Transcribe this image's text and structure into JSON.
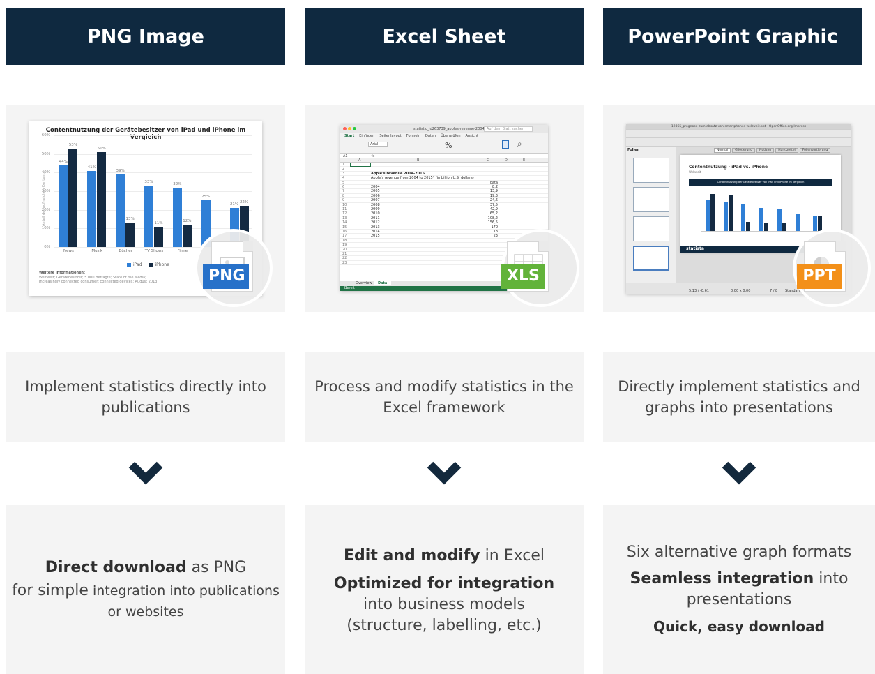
{
  "colors": {
    "header_bg": "#0f2940",
    "panel_bg": "#f4f4f4",
    "png_badge": "#2771c9",
    "xls_badge": "#62b33a",
    "ppt_badge": "#f39019",
    "ipad": "#2f7fd6",
    "iphone": "#142a42"
  },
  "columns": [
    {
      "title": "PNG Image",
      "badge": "PNG",
      "description": "Implement statistics directly into publications",
      "bottom": {
        "line1_bold": "Direct download",
        "line1_rest": " as PNG",
        "line2_big": "for simple",
        "line2_small": " integration into publications or websites"
      }
    },
    {
      "title": "Excel Sheet",
      "badge": "XLS",
      "description": "Process and modify statistics in the Excel framework",
      "bottom": {
        "p1_bold": "Edit and modify",
        "p1_rest": " in Excel",
        "p2_bold": "Optimized for integration",
        "p2_rest": "into business models",
        "p3_rest": "(structure, labelling, etc.)"
      }
    },
    {
      "title": "PowerPoint Graphic",
      "badge": "PPT",
      "description": "Directly implement statistics and graphs into presentations",
      "bottom": {
        "p1": "Six alternative graph formats",
        "p2_bold": "Seamless integration",
        "p2_rest": " into presentations",
        "p3_bold": "Quick, easy download"
      }
    }
  ],
  "png_chart": {
    "title": "Contentnutzung der Gerätebesitzer von iPad und iPhone im Vergleich",
    "ylabel": "Anteil der auf-reichen Contents",
    "yticks": [
      "60%",
      "50%",
      "40%",
      "30%",
      "20%",
      "10%",
      "0%"
    ],
    "legend": [
      "iPad",
      "iPhone"
    ],
    "footnote_title": "Weitere Informationen:",
    "footnote_l1": "Weltweit; Gerätebesitzer; 5.000 Befragte; State of the Media;",
    "footnote_l2": "Increasingly connected consumer; connected devices; August 2013"
  },
  "chart_data": {
    "type": "bar",
    "title": "Contentnutzung der Gerätebesitzer von iPad und iPhone im Vergleich",
    "categories": [
      "News",
      "Musik",
      "Bücher",
      "TV Shows",
      "Filme",
      "",
      ""
    ],
    "series": [
      {
        "name": "iPad",
        "values": [
          44,
          41,
          39,
          33,
          32,
          25,
          21
        ]
      },
      {
        "name": "iPhone",
        "values": [
          53,
          51,
          13,
          11,
          12,
          null,
          22
        ]
      }
    ],
    "value_labels_ipad": [
      "44%",
      "41%",
      "39%",
      "33%",
      "32%",
      "25%",
      "21%"
    ],
    "value_labels_iphone": [
      "53%",
      "51%",
      "13%",
      "11%",
      "12%",
      "",
      "22%"
    ],
    "ylim": [
      0,
      60
    ]
  },
  "excel": {
    "filename": "statistic_id263739_apples-revenue-2004-2015",
    "search": "Auf dem Blatt suchen",
    "tabs": [
      "Start",
      "Einfügen",
      "Seitenlayout",
      "Formeln",
      "Daten",
      "Überprüfen",
      "Ansicht"
    ],
    "font": "Arial",
    "cell_ref": "A1",
    "col_headers": [
      "A",
      "B",
      "C",
      "D",
      "E"
    ],
    "heading": "Apple's revenue 2004-2015",
    "subheading": "Apple's revenue from 2004 to 2015* (in billion U.S. dollars)",
    "data_header": "data",
    "years": [
      "2004",
      "2005",
      "2006",
      "2007",
      "2008",
      "2009",
      "2010",
      "2011",
      "2012",
      "2013",
      "2014",
      "2015"
    ],
    "values": [
      "8,2",
      "13,9",
      "19,3",
      "24,6",
      "37,5",
      "42,9",
      "65,2",
      "108,2",
      "156,5",
      "170",
      "18",
      "23"
    ],
    "sheet_tabs": [
      "Overview",
      "Data"
    ],
    "status": "Bereit"
  },
  "ppt": {
    "window_title": "12865_prognose-zum-absatz-von-smartphones-weltweit.ppt - OpenOffice.org Impress",
    "view_tabs": [
      "Normal",
      "Gliederung",
      "Notizen",
      "Handzettel",
      "Foliensortierung"
    ],
    "panel_title": "Folien",
    "slide_title": "Contentnutzung - iPad vs. iPhone",
    "slide_sub": "Weltweit",
    "slide_chart_title": "Contentnutzung der Gerätebesitzer von iPad und iPhone im Vergleich",
    "status_pos": "5.13 / -0.61",
    "status_size": "0.00 x 0.00",
    "status_page": "7 / 8",
    "status_mode": "Standard",
    "logo": "statista"
  }
}
